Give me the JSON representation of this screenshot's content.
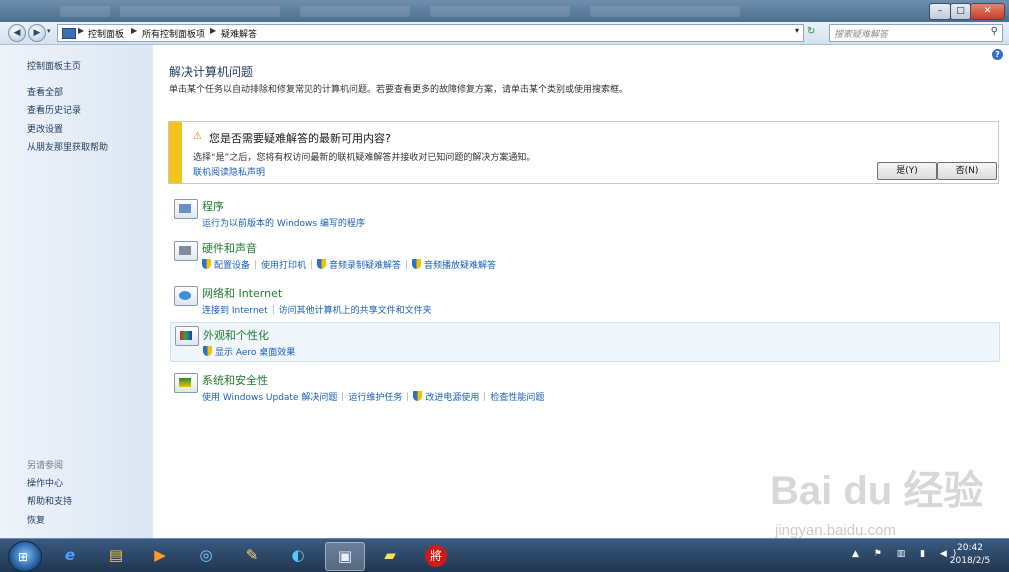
{
  "window": {
    "controls": {
      "minimize": "–",
      "maximize": "□",
      "close": "✕"
    }
  },
  "nav": {
    "back_icon": "back-arrow-icon",
    "forward_icon": "forward-arrow-icon",
    "breadcrumb": [
      "控制面板",
      "所有控制面板项",
      "疑难解答"
    ],
    "search_placeholder": "搜索疑难解答"
  },
  "sidebar": {
    "home": "控制面板主页",
    "links": [
      "查看全部",
      "查看历史记录",
      "更改设置",
      "从朋友那里获取帮助"
    ],
    "see_also_heading": "另请参阅",
    "see_also": [
      "操作中心",
      "帮助和支持",
      "恢复"
    ]
  },
  "main": {
    "title": "解决计算机问题",
    "description": "单击某个任务以自动排除和修复常见的计算机问题。若要查看更多的故障修复方案，请单击某个类别或使用搜索框。"
  },
  "notice": {
    "question": "您是否需要疑难解答的最新可用内容?",
    "detail": "选择“是”之后，您将有权访问最新的联机疑难解答并接收对已知问题的解决方案通知。",
    "privacy_link": "联机阅读隐私声明",
    "yes_label": "是(Y)",
    "no_label": "否(N)"
  },
  "categories": [
    {
      "name": "程序",
      "links": [
        {
          "text": "运行为以前版本的 Windows 编写的程序",
          "shield": false
        }
      ]
    },
    {
      "name": "硬件和声音",
      "links": [
        {
          "text": "配置设备",
          "shield": true
        },
        {
          "text": "使用打印机",
          "shield": false
        },
        {
          "text": "音频录制疑难解答",
          "shield": true
        },
        {
          "text": "音频播放疑难解答",
          "shield": true
        }
      ]
    },
    {
      "name": "网络和 Internet",
      "links": [
        {
          "text": "连接到 Internet",
          "shield": false
        },
        {
          "text": "访问其他计算机上的共享文件和文件夹",
          "shield": false
        }
      ]
    },
    {
      "name": "外观和个性化",
      "links": [
        {
          "text": "显示 Aero 桌面效果",
          "shield": true
        }
      ]
    },
    {
      "name": "系统和安全性",
      "links": [
        {
          "text": "使用 Windows Update 解决问题",
          "shield": false
        },
        {
          "text": "运行维护任务",
          "shield": false
        },
        {
          "text": "改进电源使用",
          "shield": true
        },
        {
          "text": "检查性能问题",
          "shield": false
        }
      ]
    }
  ],
  "taskbar": {
    "apps": [
      "internet-explorer-icon",
      "file-explorer-icon",
      "media-player-icon",
      "app-icon",
      "paint-icon",
      "browser-icon",
      "control-panel-icon",
      "sticky-notes-icon",
      "chess-game-icon"
    ],
    "app_glyphs": [
      "e",
      "▤",
      "▶",
      "◎",
      "✎",
      "◐",
      "▣",
      "▰",
      "將"
    ],
    "tray_icons": "▲ ⚑ ▥ ▮ ◀)",
    "time": "20:42",
    "date": "2018/2/5"
  },
  "watermark": {
    "brand": "Bai du 经验",
    "url": "jingyan.baidu.com"
  },
  "colors": {
    "accent_link": "#1a5fb4",
    "category_green": "#217a2f",
    "notice_bar": "#f3c51b"
  }
}
